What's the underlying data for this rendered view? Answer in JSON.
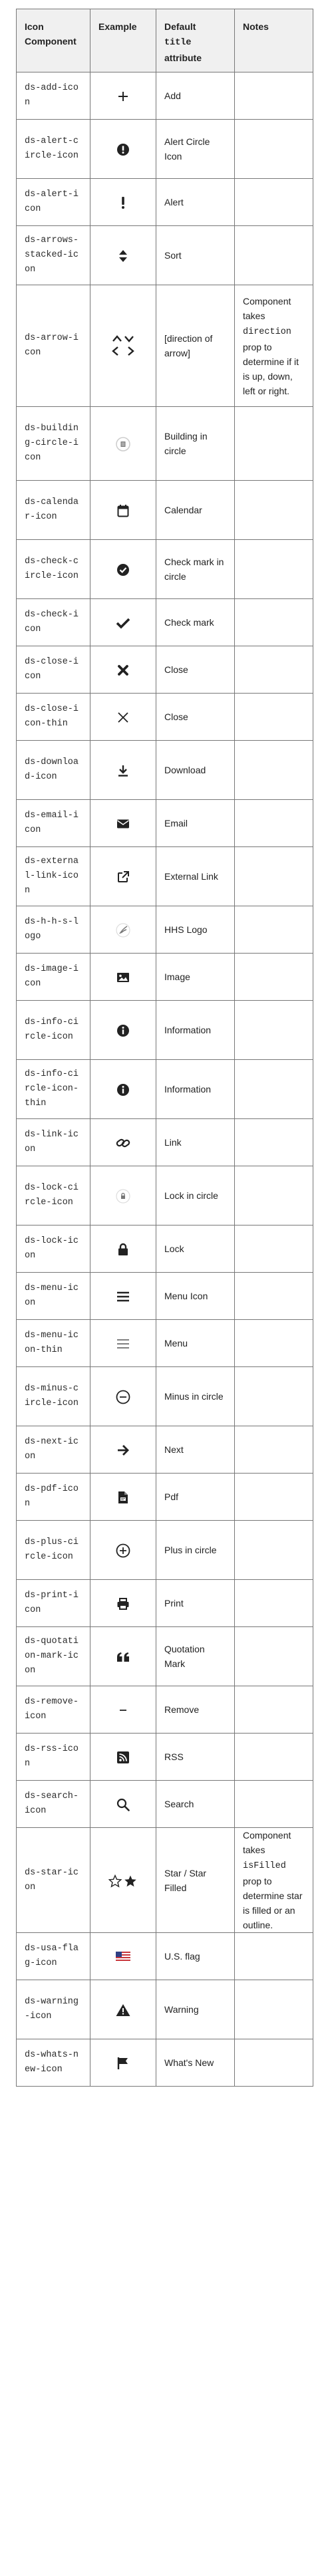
{
  "headers": {
    "component": "Icon Component",
    "example": "Example",
    "default_prefix": "Default",
    "default_code": "title",
    "default_suffix": "attribute",
    "notes": "Notes"
  },
  "rows": [
    {
      "component": "ds-add-icon",
      "icon": "plus-icon",
      "title": "Add",
      "note": ""
    },
    {
      "component": "ds-alert-circle-icon",
      "icon": "alert-circle-icon",
      "title": "Alert Circle Icon",
      "note": ""
    },
    {
      "component": "ds-alert-icon",
      "icon": "exclamation-icon",
      "title": "Alert",
      "note": ""
    },
    {
      "component": "ds-arrows-stacked-icon",
      "icon": "sort-arrows-icon",
      "title": "Sort",
      "note": ""
    },
    {
      "component": "ds-arrow-icon",
      "icon": "chevrons-icon",
      "title": "[direction of arrow]",
      "note_pre": "Component takes",
      "note_code": "direction",
      "note_post": "prop to determine if it is up, down, left or right."
    },
    {
      "component": "ds-building-circle-icon",
      "icon": "building-circle-icon",
      "title": "Building in circle",
      "note": ""
    },
    {
      "component": "ds-calendar-icon",
      "icon": "calendar-icon",
      "title": "Calendar",
      "note": ""
    },
    {
      "component": "ds-check-circle-icon",
      "icon": "check-circle-icon",
      "title": "Check mark in circle",
      "note": ""
    },
    {
      "component": "ds-check-icon",
      "icon": "check-icon",
      "title": "Check mark",
      "note": ""
    },
    {
      "component": "ds-close-icon",
      "icon": "close-bold-icon",
      "title": "Close",
      "note": ""
    },
    {
      "component": "ds-close-icon-thin",
      "icon": "close-thin-icon",
      "title": "Close",
      "note": ""
    },
    {
      "component": "ds-download-icon",
      "icon": "download-icon",
      "title": "Download",
      "note": ""
    },
    {
      "component": "ds-email-icon",
      "icon": "envelope-icon",
      "title": "Email",
      "note": ""
    },
    {
      "component": "ds-external-link-icon",
      "icon": "external-link-icon",
      "title": "External Link",
      "note": ""
    },
    {
      "component": "ds-h-h-s-logo",
      "icon": "hhs-logo-icon",
      "title": "HHS Logo",
      "note": ""
    },
    {
      "component": "ds-image-icon",
      "icon": "image-icon",
      "title": "Image",
      "note": ""
    },
    {
      "component": "ds-info-circle-icon",
      "icon": "info-circle-icon",
      "title": "Information",
      "note": ""
    },
    {
      "component": "ds-info-circle-icon-thin",
      "icon": "info-circle-icon",
      "title": "Information",
      "note": ""
    },
    {
      "component": "ds-link-icon",
      "icon": "link-icon",
      "title": "Link",
      "note": ""
    },
    {
      "component": "ds-lock-circle-icon",
      "icon": "lock-circle-icon",
      "title": "Lock in circle",
      "note": ""
    },
    {
      "component": "ds-lock-icon",
      "icon": "lock-icon",
      "title": "Lock",
      "note": ""
    },
    {
      "component": "ds-menu-icon",
      "icon": "menu-bold-icon",
      "title": "Menu Icon",
      "note": ""
    },
    {
      "component": "ds-menu-icon-thin",
      "icon": "menu-thin-icon",
      "title": "Menu",
      "note": ""
    },
    {
      "component": "ds-minus-circle-icon",
      "icon": "minus-circle-icon",
      "title": "Minus in circle",
      "note": ""
    },
    {
      "component": "ds-next-icon",
      "icon": "arrow-right-icon",
      "title": "Next",
      "note": ""
    },
    {
      "component": "ds-pdf-icon",
      "icon": "pdf-icon",
      "title": "Pdf",
      "note": ""
    },
    {
      "component": "ds-plus-circle-icon",
      "icon": "plus-circle-icon",
      "title": "Plus in circle",
      "note": ""
    },
    {
      "component": "ds-print-icon",
      "icon": "printer-icon",
      "title": "Print",
      "note": ""
    },
    {
      "component": "ds-quotation-mark-icon",
      "icon": "quotation-mark-icon",
      "title": "Quotation Mark",
      "note": ""
    },
    {
      "component": "ds-remove-icon",
      "icon": "minus-icon",
      "title": "Remove",
      "note": ""
    },
    {
      "component": "ds-rss-icon",
      "icon": "rss-icon",
      "title": "RSS",
      "note": ""
    },
    {
      "component": "ds-search-icon",
      "icon": "search-icon",
      "title": "Search",
      "note": ""
    },
    {
      "component": "ds-star-icon",
      "icon": "star-pair-icon",
      "title": "Star / Star Filled",
      "note_pre": "Component takes",
      "note_code": "isFilled",
      "note_post": "prop to determine star is filled or an outline."
    },
    {
      "component": "ds-usa-flag-icon",
      "icon": "usa-flag-icon",
      "title": "U.S. flag",
      "note": ""
    },
    {
      "component": "ds-warning-icon",
      "icon": "warning-icon",
      "title": "Warning",
      "note": ""
    },
    {
      "component": "ds-whats-new-icon",
      "icon": "flag-icon",
      "title": "What's New",
      "note": ""
    }
  ]
}
